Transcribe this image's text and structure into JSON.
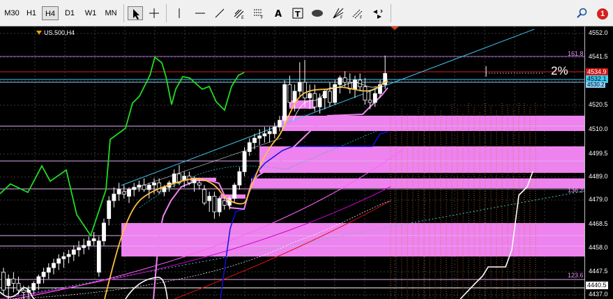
{
  "toolbar": {
    "timeframes": [
      "M30",
      "H1",
      "H4",
      "D1",
      "W1",
      "MN"
    ],
    "active_timeframe": "H4",
    "notification_count": "1"
  },
  "chart": {
    "symbol_label": "US.500,H4",
    "percent_label": "2%",
    "fib_labels": {
      "f1618": "161.8",
      "f1362": "136.2",
      "f1236": "123.6"
    },
    "price_axis": [
      "4552.0",
      "4541.5",
      "4530.2",
      "4520.5",
      "4510.0",
      "4499.5",
      "4489.0",
      "4479.0",
      "4468.5",
      "4458.0",
      "4447.5",
      "4437.0"
    ],
    "price_tags": {
      "tag1": "4534.9",
      "tag2": "4532.1",
      "tag3": "4440.5"
    }
  },
  "colors": {
    "background": "#000000",
    "zone": "#ee82ee",
    "ema_yellow": "#ffc040",
    "ma_blue": "#1010dd",
    "ma_red": "#dd1010",
    "ma_magenta": "#cc00cc",
    "oscillator": "#20dd20",
    "trend_cyan": "#40c8f0"
  },
  "chart_data": {
    "type": "candlestick",
    "ylim": [
      4434,
      4556
    ],
    "candles": [
      [
        4446,
        4448,
        4436,
        4438
      ],
      [
        4440,
        4445,
        4434,
        4443
      ],
      [
        4443,
        4446,
        4437,
        4441
      ],
      [
        4441,
        4444,
        4436,
        4438
      ],
      [
        4438,
        4440,
        4434,
        4437
      ],
      [
        4437,
        4440,
        4434,
        4438
      ],
      [
        4438,
        4442,
        4436,
        4441
      ],
      [
        4441,
        4445,
        4438,
        4444
      ],
      [
        4444,
        4448,
        4441,
        4446
      ],
      [
        4446,
        4450,
        4443,
        4448
      ],
      [
        4448,
        4452,
        4445,
        4450
      ],
      [
        4450,
        4454,
        4447,
        4452
      ],
      [
        4452,
        4455,
        4448,
        4453
      ],
      [
        4453,
        4456,
        4450,
        4454
      ],
      [
        4454,
        4458,
        4451,
        4456
      ],
      [
        4456,
        4460,
        4453,
        4457
      ],
      [
        4457,
        4461,
        4454,
        4458
      ],
      [
        4458,
        4462,
        4456,
        4460
      ],
      [
        4460,
        4464,
        4458,
        4461
      ],
      [
        4446,
        4462,
        4444,
        4460
      ],
      [
        4460,
        4470,
        4458,
        4468
      ],
      [
        4470,
        4480,
        4467,
        4478
      ],
      [
        4478,
        4484,
        4475,
        4481
      ],
      [
        4481,
        4486,
        4478,
        4483
      ],
      [
        4482,
        4485,
        4479,
        4481
      ],
      [
        4480,
        4484,
        4477,
        4483
      ],
      [
        4483,
        4486,
        4480,
        4484
      ],
      [
        4484,
        4487,
        4482,
        4485
      ],
      [
        4485,
        4488,
        4482,
        4483
      ],
      [
        4483,
        4486,
        4479,
        4485
      ],
      [
        4485,
        4488,
        4481,
        4486
      ],
      [
        4486,
        4488,
        4481,
        4482
      ],
      [
        4482,
        4485,
        4480,
        4484
      ],
      [
        4484,
        4487,
        4482,
        4486
      ],
      [
        4486,
        4492,
        4484,
        4490
      ],
      [
        4490,
        4494,
        4485,
        4486
      ],
      [
        4487,
        4491,
        4484,
        4489
      ],
      [
        4489,
        4491,
        4485,
        4486
      ],
      [
        4486,
        4489,
        4482,
        4488
      ],
      [
        4486,
        4488,
        4483,
        4485
      ],
      [
        4483,
        4485,
        4476,
        4477
      ],
      [
        4478,
        4482,
        4473,
        4480
      ],
      [
        4480,
        4482,
        4470,
        4473
      ],
      [
        4473,
        4480,
        4471,
        4479
      ],
      [
        4478,
        4480,
        4474,
        4476
      ],
      [
        4476,
        4480,
        4474,
        4479
      ],
      [
        4479,
        4486,
        4477,
        4485
      ],
      [
        4485,
        4493,
        4483,
        4491
      ],
      [
        4491,
        4502,
        4489,
        4500
      ],
      [
        4500,
        4506,
        4498,
        4504
      ],
      [
        4504,
        4508,
        4501,
        4506
      ],
      [
        4506,
        4510,
        4503,
        4507
      ],
      [
        4507,
        4511,
        4504,
        4508
      ],
      [
        4508,
        4511,
        4504,
        4509
      ],
      [
        4508,
        4513,
        4506,
        4511
      ],
      [
        4511,
        4516,
        4509,
        4514
      ],
      [
        4514,
        4532,
        4512,
        4530
      ],
      [
        4530,
        4534,
        4520,
        4522
      ],
      [
        4522,
        4530,
        4518,
        4527
      ],
      [
        4527,
        4540,
        4525,
        4531
      ],
      [
        4531,
        4541,
        4520,
        4524
      ],
      [
        4524,
        4530,
        4519,
        4526
      ],
      [
        4526,
        4530,
        4518,
        4520
      ],
      [
        4520,
        4526,
        4517,
        4524
      ],
      [
        4524,
        4528,
        4519,
        4527
      ],
      [
        4527,
        4531,
        4520,
        4522
      ],
      [
        4522,
        4532,
        4521,
        4530
      ],
      [
        4530,
        4534,
        4526,
        4533
      ],
      [
        4533,
        4536,
        4529,
        4531
      ],
      [
        4531,
        4535,
        4526,
        4528
      ],
      [
        4528,
        4534,
        4524,
        4532
      ],
      [
        4532,
        4535,
        4527,
        4529
      ],
      [
        4529,
        4533,
        4521,
        4523
      ],
      [
        4523,
        4527,
        4519,
        4522
      ],
      [
        4522,
        4528,
        4520,
        4526
      ],
      [
        4526,
        4532,
        4524,
        4530
      ],
      [
        4530,
        4543,
        4528,
        4535
      ]
    ]
  }
}
